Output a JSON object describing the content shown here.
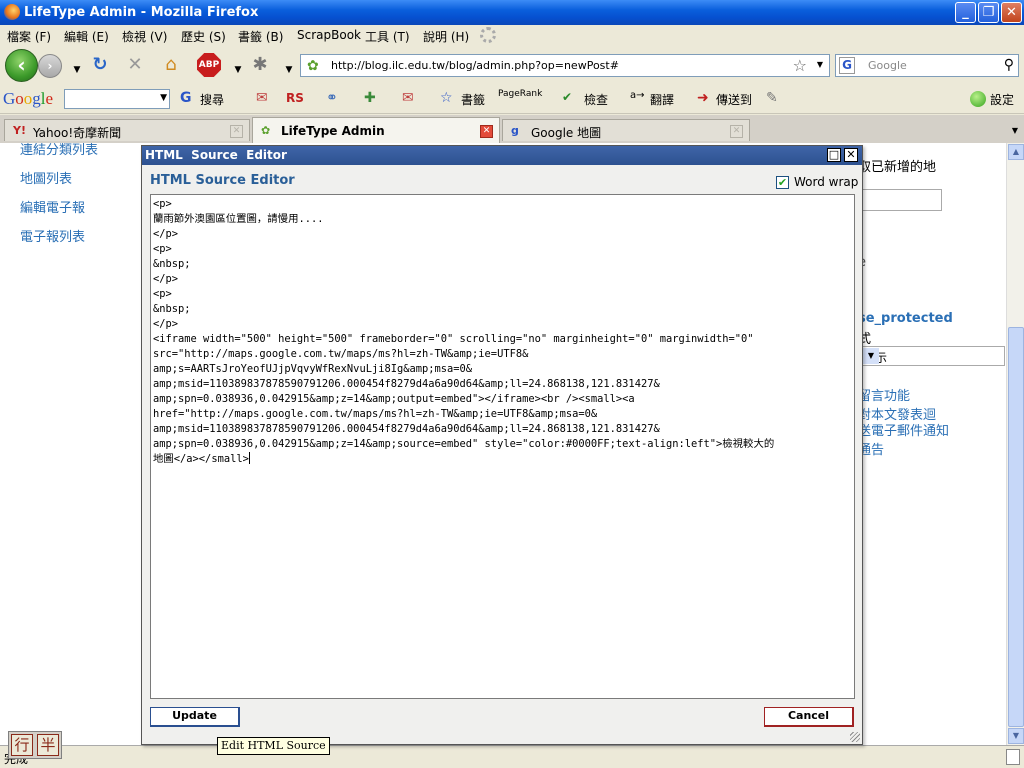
{
  "window": {
    "title": "LifeType Admin - Mozilla Firefox",
    "minimize": "_",
    "maximize": "❐",
    "close": "✕"
  },
  "menu": [
    "檔案 (F)",
    "編輯 (E)",
    "檢視 (V)",
    "歷史 (S)",
    "書籤 (B)",
    "ScrapBook",
    "工具 (T)",
    "說明 (H)"
  ],
  "navigation": {
    "url": "http://blog.ilc.edu.tw/blog/admin.php?op=newPost#",
    "search_placeholder": "Google",
    "abp_label": "ABP"
  },
  "google_toolbar": {
    "logo": [
      "G",
      "o",
      "o",
      "g",
      "l",
      "e"
    ],
    "search_label": "搜尋",
    "rs_label": "RS",
    "bookmarks_label": "書籤",
    "pagerank_label": "PageRank",
    "spellcheck_label": "檢查",
    "translate_label": "翻譯",
    "sendto_label": "傳送到",
    "settings_label": "設定"
  },
  "tabs": [
    {
      "label": "Yahoo!奇摩新聞",
      "icon": "Y!",
      "active": false
    },
    {
      "label": "LifeType Admin",
      "icon": "✿",
      "active": true
    },
    {
      "label": "Google 地圖",
      "icon": "g",
      "active": false
    }
  ],
  "left_nav": [
    "連結分類列表",
    "地圖列表",
    "編輯電子報",
    "電子報列表"
  ],
  "right_column": {
    "line1": "取已新增的地",
    "line2": "e",
    "protected": "se_protected",
    "format": "式",
    "select_value": "顯示",
    "link1": "留言功能",
    "link2": "對本文發表迴",
    "link3": "送電子郵件通知",
    "link4": "通告"
  },
  "dialog": {
    "title": "HTML  Source  Editor",
    "heading": "HTML Source Editor",
    "word_wrap_label": "Word wrap",
    "word_wrap_checked": true,
    "content": "<p>\n蘭雨節外澳園區位置圖，請慢用....\n</p>\n<p>\n&nbsp;\n</p>\n<p>\n&nbsp;\n</p>\n<iframe width=\"500\" height=\"500\" frameborder=\"0\" scrolling=\"no\" marginheight=\"0\" marginwidth=\"0\"\nsrc=\"http://maps.google.com.tw/maps/ms?hl=zh-TW&amp;ie=UTF8&\namp;s=AARTsJroYeofUJjpVqvyWfRexNvuLji8Ig&amp;msa=0&\namp;msid=110389837878590791206.000454f8279d4a6a90d64&amp;ll=24.868138,121.831427&\namp;spn=0.038936,0.042915&amp;z=14&amp;output=embed\"></iframe><br /><small><a\nhref=\"http://maps.google.com.tw/maps/ms?hl=zh-TW&amp;ie=UTF8&amp;msa=0&\namp;msid=110389837878590791206.000454f8279d4a6a90d64&amp;ll=24.868138,121.831427&\namp;spn=0.038936,0.042915&amp;z=14&amp;source=embed\" style=\"color:#0000FF;text-align:left\">檢視較大的\n地圖</a></small>",
    "update_label": "Update",
    "cancel_label": "Cancel"
  },
  "tooltip": "Edit HTML Source",
  "status_text": "完成",
  "ime": [
    "行",
    "半"
  ]
}
